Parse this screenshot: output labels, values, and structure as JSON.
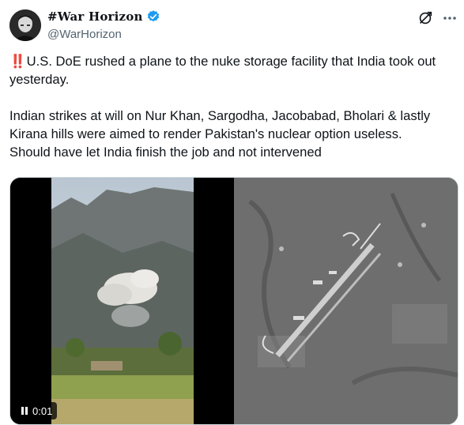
{
  "author": {
    "display_name": "#War Horizon",
    "handle": "@WarHorizon",
    "verified": true,
    "verified_color": "#1d9bf0"
  },
  "icons": {
    "grok": "grok-icon",
    "more": "more-icon",
    "verified": "verified-badge-icon",
    "pause": "pause-icon",
    "alert": "double-exclamation-icon"
  },
  "tweet": {
    "line1_emoji": "‼️",
    "paragraph1": "U.S. DoE rushed a plane to the nuke storage facility that India took out yesterday.",
    "paragraph2": "Indian strikes at will on Nur Khan, Sargodha, Jacobabad, Bholari & lastly Kirana hills were aimed to render Pakistan's nuclear option useless.",
    "paragraph3": "Should have let India finish the job and not intervened"
  },
  "media": {
    "video_time": "0:01"
  }
}
